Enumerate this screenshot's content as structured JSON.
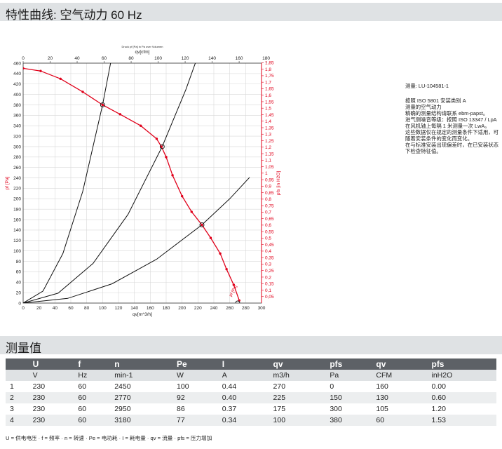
{
  "header": {
    "title": "特性曲线: 空气动力 60 Hz"
  },
  "section2": {
    "title": "测量值"
  },
  "measurement_id": "测量: LU-104581-1",
  "notes": [
    "按照 ISO 5801 安装类别 A",
    "测量的空气动力",
    "精确的测量结构请联系 ebm-papst。",
    "进气侧噪音等级：按照 ISO 13347 / LpA 在风机轴上每隔 1 米测量一次 LwA。",
    "这些数据仅在规定的测量条件下适用，可随着安装条件的变化而变化。",
    "在与标准安装出现偏差时，在已安装状态下检查特征值。"
  ],
  "table": {
    "header1": [
      "",
      "U",
      "f",
      "n",
      "Pe",
      "I",
      "qv",
      "pfs",
      "qv",
      "pfs"
    ],
    "header2": [
      "",
      "V",
      "Hz",
      "min-1",
      "W",
      "A",
      "m3/h",
      "Pa",
      "CFM",
      "inH2O"
    ],
    "rows": [
      [
        "1",
        "230",
        "60",
        "2450",
        "100",
        "0.44",
        "270",
        "0",
        "160",
        "0.00"
      ],
      [
        "2",
        "230",
        "60",
        "2770",
        "92",
        "0.40",
        "225",
        "150",
        "130",
        "0.60"
      ],
      [
        "3",
        "230",
        "60",
        "2950",
        "86",
        "0.37",
        "175",
        "300",
        "105",
        "1.20"
      ],
      [
        "4",
        "230",
        "60",
        "3180",
        "77",
        "0.34",
        "100",
        "380",
        "60",
        "1.53"
      ]
    ]
  },
  "legend": "U = 供电电压 · f = 频率 · n = 转速 · Pe = 电功耗 · I = 耗电量 · qv = 流量 · pfs = 压力增加",
  "chart_data": {
    "type": "line",
    "xlabel": "qv[m^3/h]",
    "x2label": "qv[cfm]",
    "ylabel": "pf [Pa]",
    "y2label": "pfs [in H2O]",
    "top_caption": "Druck pf [Pa] in Pa over Volumen",
    "curve_label": "pf [Pa]",
    "xlim": [
      0,
      300
    ],
    "ylim": [
      0,
      460
    ],
    "xticks": [
      "0",
      "20",
      "40",
      "60",
      "80",
      "100",
      "120",
      "140",
      "160",
      "180",
      "200",
      "220",
      "240",
      "260",
      "280",
      "300"
    ],
    "yticks": [
      "0",
      "20",
      "40",
      "60",
      "80",
      "100",
      "120",
      "140",
      "160",
      "180",
      "200",
      "220",
      "240",
      "260",
      "280",
      "300",
      "320",
      "340",
      "360",
      "380",
      "400",
      "420",
      "440",
      "460"
    ],
    "x2ticks": [
      "0",
      "20",
      "40",
      "60",
      "80",
      "100",
      "120",
      "140",
      "160",
      "180"
    ],
    "y2ticks": [
      "0,05",
      "0,1",
      "0,15",
      "0,2",
      "0,25",
      "0,3",
      "0,35",
      "0,4",
      "0,45",
      "0,5",
      "0,55",
      "0,6",
      "0,65",
      "0,7",
      "0,75",
      "0,8",
      "0,85",
      "0,9",
      "0,95",
      "1",
      "1,05",
      "1,1",
      "1,15",
      "1,2",
      "1,25",
      "1,3",
      "1,35",
      "1,4",
      "1,45",
      "1,5",
      "1,55",
      "1,6",
      "1,65",
      "1,7",
      "1,75",
      "1,8",
      "1,85"
    ],
    "colors": {
      "fan_curve": "#e0001a",
      "system_curves": "#111111",
      "axis_right": "#e0001a"
    },
    "fan_curve": {
      "x": [
        0,
        22,
        47,
        75,
        100,
        122,
        148,
        168,
        174,
        180,
        188,
        200,
        212,
        225,
        236,
        248,
        256,
        265,
        272
      ],
      "y": [
        450,
        445,
        430,
        405,
        380,
        362,
        340,
        315,
        300,
        280,
        245,
        205,
        175,
        150,
        125,
        95,
        65,
        35,
        5
      ]
    },
    "system_curves": [
      {
        "x": [
          0,
          25,
          50,
          75,
          100,
          110,
          120
        ],
        "y": [
          0,
          23,
          95,
          214,
          380,
          460,
          548
        ]
      },
      {
        "x": [
          0,
          44,
          88,
          132,
          175,
          205,
          230
        ],
        "y": [
          0,
          19,
          76,
          170,
          300,
          410,
          517
        ]
      },
      {
        "x": [
          0,
          56,
          112,
          168,
          225,
          260,
          285
        ],
        "y": [
          0,
          9,
          37,
          84,
          150,
          200,
          241
        ]
      }
    ],
    "operating_points": [
      {
        "x": 270,
        "y": 0
      },
      {
        "x": 225,
        "y": 150
      },
      {
        "x": 175,
        "y": 300
      },
      {
        "x": 100,
        "y": 380
      }
    ]
  }
}
